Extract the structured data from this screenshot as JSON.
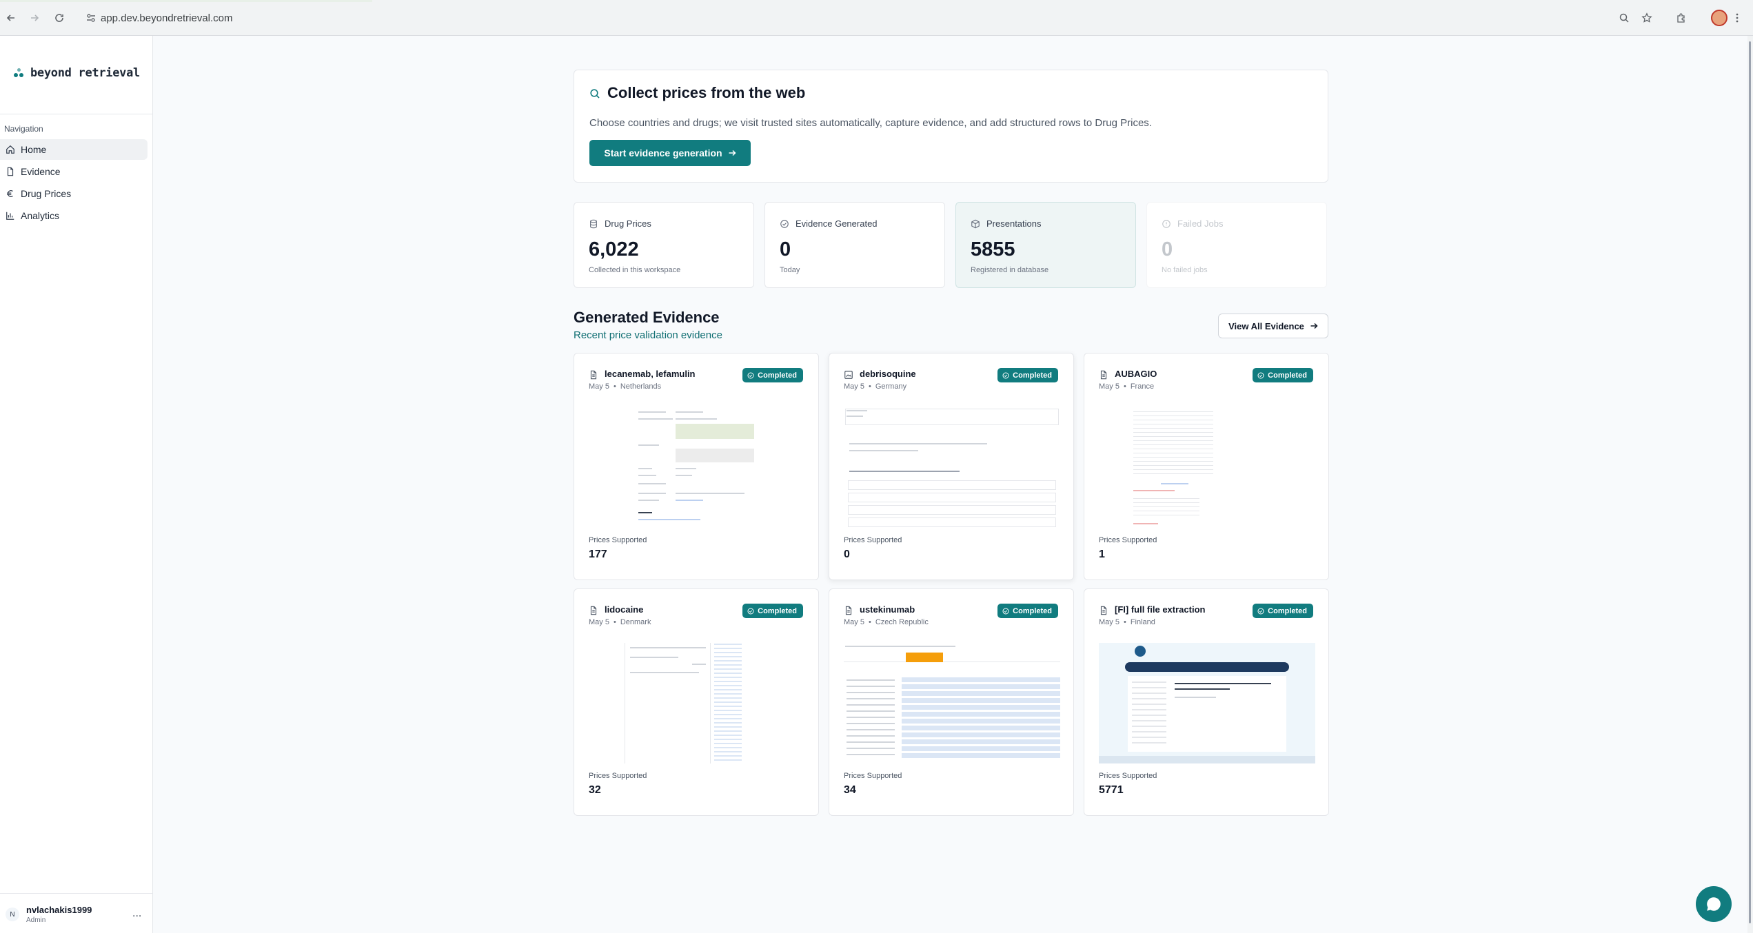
{
  "browser": {
    "url": "app.dev.beyondretrieval.com"
  },
  "sidebar": {
    "brand": "beyond retrieval",
    "nav_heading": "Navigation",
    "items": [
      {
        "label": "Home",
        "icon": "home-icon",
        "active": true
      },
      {
        "label": "Evidence",
        "icon": "document-icon",
        "active": false
      },
      {
        "label": "Drug Prices",
        "icon": "euro-icon",
        "active": false
      },
      {
        "label": "Analytics",
        "icon": "bar-chart-icon",
        "active": false
      }
    ],
    "user": {
      "initial": "N",
      "name": "nvlachakis1999",
      "role": "Admin",
      "menu": "..."
    }
  },
  "hero": {
    "title": "Collect prices from the web",
    "description": "Choose countries and drugs; we visit trusted sites automatically, capture evidence, and add structured rows to Drug Prices.",
    "button_label": "Start evidence generation"
  },
  "stats": [
    {
      "label": "Drug Prices",
      "value": "6,022",
      "sub": "Collected in this workspace"
    },
    {
      "label": "Evidence Generated",
      "value": "0",
      "sub": "Today"
    },
    {
      "label": "Presentations",
      "value": "5855",
      "sub": "Registered in database"
    },
    {
      "label": "Failed Jobs",
      "value": "0",
      "sub": "No failed jobs"
    }
  ],
  "evidence_section": {
    "title": "Generated Evidence",
    "subtitle": "Recent price validation evidence",
    "view_all_label": "View All Evidence",
    "ps_label": "Prices Supported",
    "items": [
      {
        "name": "lecanemab, lefamulin",
        "date": "May 5",
        "country": "Netherlands",
        "status": "Completed",
        "prices_supported": "177"
      },
      {
        "name": "debrisoquine",
        "date": "May 5",
        "country": "Germany",
        "status": "Completed",
        "prices_supported": "0"
      },
      {
        "name": "AUBAGIO",
        "date": "May 5",
        "country": "France",
        "status": "Completed",
        "prices_supported": "1"
      },
      {
        "name": "lidocaine",
        "date": "May 5",
        "country": "Denmark",
        "status": "Completed",
        "prices_supported": "32"
      },
      {
        "name": "ustekinumab",
        "date": "May 5",
        "country": "Czech Republic",
        "status": "Completed",
        "prices_supported": "34"
      },
      {
        "name": "[FI] full file extraction",
        "date": "May 5",
        "country": "Finland",
        "status": "Completed",
        "prices_supported": "5771"
      }
    ]
  },
  "colors": {
    "accent": "#117c7f",
    "background": "#f8fafc"
  }
}
